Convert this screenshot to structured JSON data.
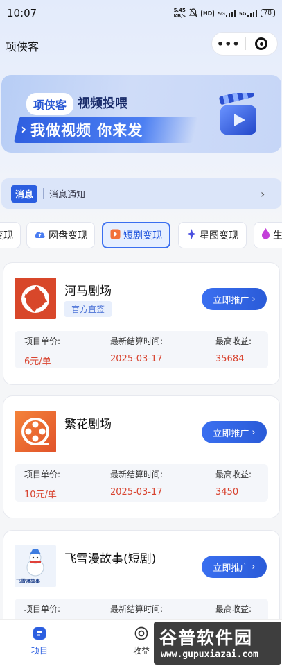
{
  "status_bar": {
    "time": "10:07",
    "speed": "5.45",
    "speed_unit": "KB/s",
    "hd_label": "HD",
    "net1": "5G",
    "net2": "5G",
    "battery": "78"
  },
  "nav": {
    "title": "项侠客",
    "more_label": "•••"
  },
  "banner": {
    "brand": "项侠客",
    "slogan1": "视频投喂",
    "slogan2": "我做视频 你来发",
    "accent": "#2b5ee0"
  },
  "notice": {
    "tag": "消息",
    "text": "消息通知"
  },
  "tabs": [
    {
      "label": "变现"
    },
    {
      "label": "网盘变现"
    },
    {
      "label": "短剧变现"
    },
    {
      "label": "星图变现"
    },
    {
      "label": "生"
    }
  ],
  "cards": [
    {
      "name": "河马剧场",
      "badge": "官方直签",
      "promote": "立即推广",
      "unit_label": "项目单价:",
      "unit_value": "6元/单",
      "date_label": "最新结算时间:",
      "date_value": "2025-03-17",
      "max_label": "最高收益:",
      "max_value": "35684"
    },
    {
      "name": "繁花剧场",
      "promote": "立即推广",
      "unit_label": "项目单价:",
      "unit_value": "10元/单",
      "date_label": "最新结算时间:",
      "date_value": "2025-03-17",
      "max_label": "最高收益:",
      "max_value": "3450"
    },
    {
      "name": "飞雪漫故事(短剧)",
      "logo_text": "飞雪漫故事",
      "promote": "立即推广",
      "unit_label": "项目单价:",
      "date_label": "最新结算时间:",
      "max_label": "最高收益:"
    }
  ],
  "tabbar": {
    "items": [
      {
        "label": "项目"
      },
      {
        "label": "收益"
      }
    ],
    "active_color": "#2b5ee0"
  },
  "watermark": {
    "text": "谷普软件园",
    "url": "www.gupuxiazai.com"
  }
}
